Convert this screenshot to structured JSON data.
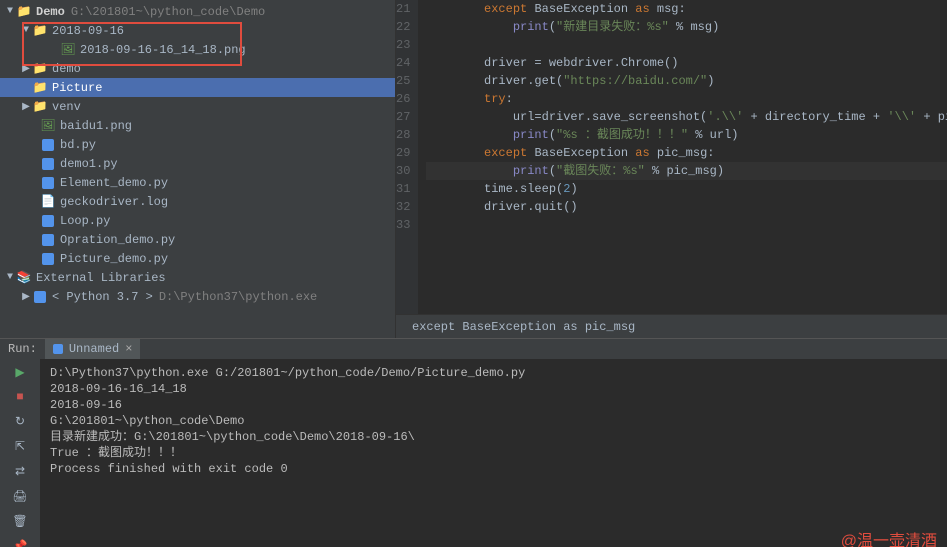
{
  "project": {
    "name": "Demo",
    "path": "G:\\201801~\\python_code\\Demo"
  },
  "tree": {
    "folder_date": "2018-09-16",
    "png_file": "2018-09-16-16_14_18.png",
    "demo_folder": "demo",
    "picture_folder": "Picture",
    "venv_folder": "venv",
    "files": {
      "baidu1": "baidu1.png",
      "bd": "bd.py",
      "demo1": "demo1.py",
      "element": "Element_demo.py",
      "gecko": "geckodriver.log",
      "loop": "Loop.py",
      "opration": "Opration_demo.py",
      "picture": "Picture_demo.py"
    },
    "ext_lib": "External Libraries",
    "python37": "< Python 3.7 >",
    "python37_path": "D:\\Python37\\python.exe"
  },
  "code": {
    "lines": {
      "21": {
        "indent": 2,
        "raw": "except BaseException as msg:"
      },
      "22": {
        "indent": 3,
        "raw": "print(\"新建目录失败：%s\" % msg)"
      },
      "24": {
        "indent": 2,
        "raw": "driver = webdriver.Chrome()"
      },
      "25": {
        "indent": 2,
        "raw": "driver.get(\"https://baidu.com/\")"
      },
      "26": {
        "indent": 2,
        "raw": "try:"
      },
      "27": {
        "indent": 3,
        "raw": "url=driver.save_screenshot('.\\\\' + directory_time + '\\\\' + picture_time + '.png')"
      },
      "28": {
        "indent": 3,
        "raw": "print(\"%s ：截图成功！！！\" % url)"
      },
      "29": {
        "indent": 2,
        "raw": "except BaseException as pic_msg:"
      },
      "30": {
        "indent": 3,
        "raw": "print(\"截图失败：%s\" % pic_msg)"
      },
      "31": {
        "indent": 2,
        "raw": "time.sleep(2)"
      },
      "32": {
        "indent": 2,
        "raw": "driver.quit()"
      }
    },
    "line_numbers": [
      "21",
      "22",
      "23",
      "24",
      "25",
      "26",
      "27",
      "28",
      "29",
      "30",
      "31",
      "32",
      "33"
    ]
  },
  "breadcrumb": "except BaseException as pic_msg",
  "run": {
    "label": "Run:",
    "tab_name": "Unnamed",
    "output": [
      "D:\\Python37\\python.exe G:/201801~/python_code/Demo/Picture_demo.py",
      "2018-09-16-16_14_18",
      "2018-09-16",
      "G:\\201801~\\python_code\\Demo",
      "目录新建成功：G:\\201801~\\python_code\\Demo\\2018-09-16\\",
      "True ：截图成功！！！",
      "",
      "Process finished with exit code 0"
    ]
  },
  "watermark": "@温一壶清酒"
}
